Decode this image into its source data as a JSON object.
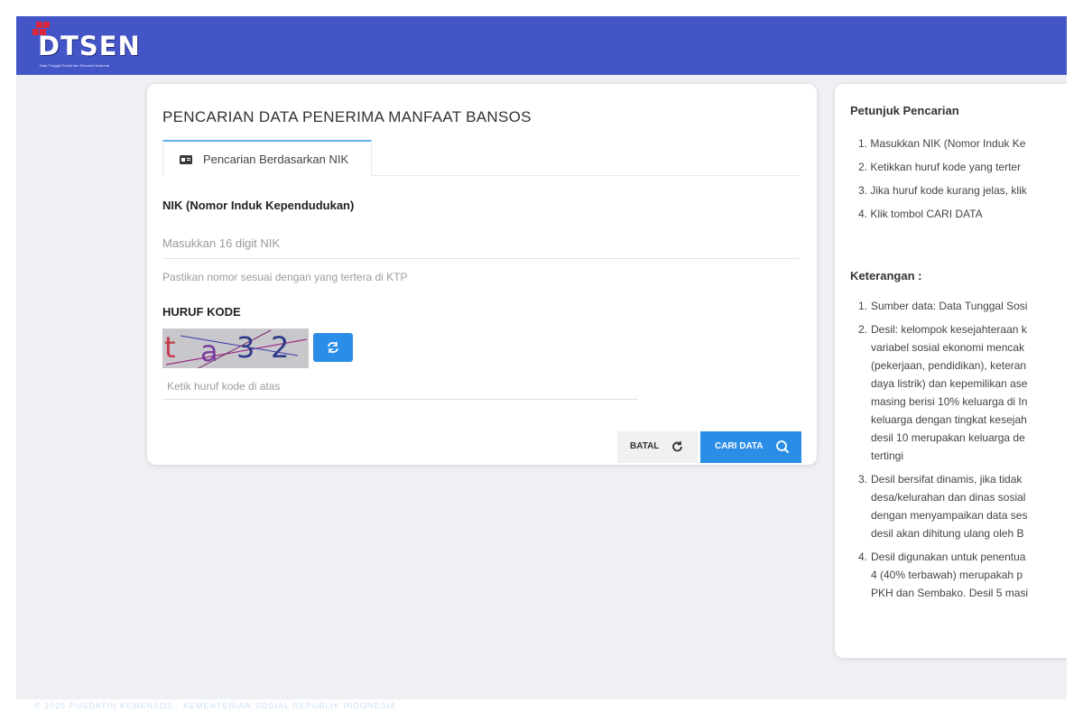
{
  "header": {
    "logo_text": "DTSEN",
    "logo_tagline": "Data Tunggal Sosial dan Ekonomi Nasional"
  },
  "search": {
    "title": "PENCARIAN DATA PENERIMA MANFAAT BANSOS",
    "tab_label": "Pencarian Berdasarkan NIK",
    "nik_label": "NIK (Nomor Induk Kependudukan)",
    "nik_placeholder": "Masukkan 16 digit NIK",
    "nik_value": "",
    "nik_help": "Pastikan nomor sesuai dengan yang tertera di KTP",
    "captcha_label": "HURUF KODE",
    "captcha_chars": [
      "t",
      "a",
      "3",
      "2"
    ],
    "captcha_placeholder": "Ketik huruf kode di atas",
    "captcha_value": "",
    "cancel_label": "BATAL",
    "submit_label": "CARI DATA"
  },
  "guide": {
    "title": "Petunjuk Pencarian",
    "steps": [
      "1. Masukkan NIK (Nomor Induk Ke",
      "2. Ketikkan huruf kode yang terter",
      "3. Jika huruf kode kurang jelas, klik",
      "4. Klik tombol CARI DATA"
    ],
    "notes_title": "Keterangan :",
    "notes": [
      {
        "num": "1.",
        "lines": [
          "Sumber data: Data Tunggal Sosi"
        ]
      },
      {
        "num": "2.",
        "lines": [
          "Desil: kelompok kesejahteraan k",
          "variabel sosial ekonomi mencak",
          "(pekerjaan, pendidikan), keteran",
          "daya listrik) dan kepemilikan ase",
          "masing berisi 10% keluarga di In",
          "keluarga dengan tingkat kesejah",
          "desil 10 merupakan keluarga de",
          "tertingi"
        ]
      },
      {
        "num": "3.",
        "lines": [
          "Desil bersifat dinamis, jika tidak",
          "desa/kelurahan dan dinas sosial",
          "dengan menyampaikan data ses",
          "desil akan dihitung ulang oleh B"
        ]
      },
      {
        "num": "4.",
        "lines": [
          "Desil digunakan untuk penentua",
          "4 (40% terbawah) merupakah p",
          "PKH dan Sembako. Desil 5 masi"
        ]
      }
    ]
  },
  "footer": {
    "text": "© 2025 PUSDATIN KEMENSOS · KEMENTERIAN SOSIAL REPUBLIK INDONESIA"
  },
  "colors": {
    "navbar": "#4355c7",
    "accent": "#2a8de6",
    "tab_border": "#5fb3ea",
    "logo_mark": "#d9263a",
    "background": "#eff0f4"
  }
}
